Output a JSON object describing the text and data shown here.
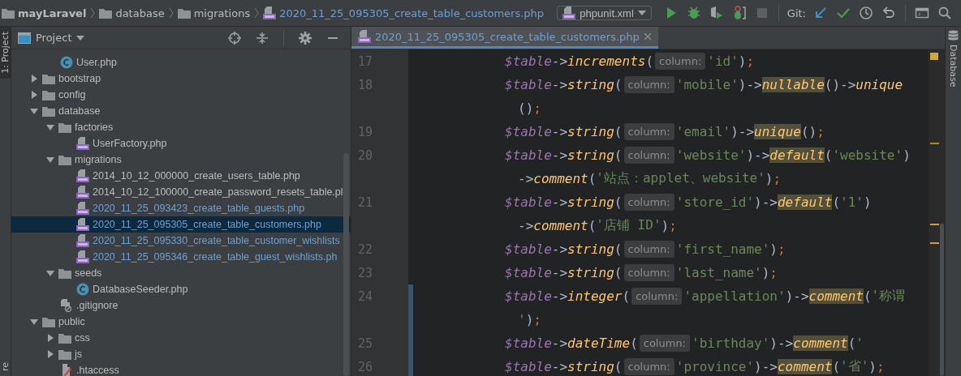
{
  "breadcrumbs": [
    {
      "kind": "project",
      "label": "mayLaravel"
    },
    {
      "kind": "folder",
      "label": "database"
    },
    {
      "kind": "folder",
      "label": "migrations"
    },
    {
      "kind": "php",
      "label": "2020_11_25_095305_create_table_customers.php"
    }
  ],
  "run_config": {
    "label": "phpunit.xml"
  },
  "vcs": {
    "label": "Git:"
  },
  "left_strip": [
    {
      "label": "1: Project",
      "selected": true
    },
    {
      "label": "re",
      "selected": false
    }
  ],
  "right_strip": [
    {
      "label": "Database"
    }
  ],
  "project_panel": {
    "title": "Project",
    "tree": {
      "continued_children": [
        {
          "kind": "class",
          "name": "User.php",
          "modified": false,
          "selected": false
        }
      ],
      "items": [
        {
          "kind": "folder",
          "name": "bootstrap",
          "expanded": false,
          "modified": false,
          "selected": false
        },
        {
          "kind": "folder",
          "name": "config",
          "expanded": false,
          "modified": false,
          "selected": false
        },
        {
          "kind": "folder",
          "name": "database",
          "expanded": true,
          "modified": false,
          "selected": false,
          "children": [
            {
              "kind": "folder",
              "name": "factories",
              "expanded": true,
              "modified": false,
              "selected": false,
              "children": [
                {
                  "kind": "php",
                  "name": "UserFactory.php",
                  "modified": false,
                  "selected": false
                }
              ]
            },
            {
              "kind": "folder",
              "name": "migrations",
              "expanded": true,
              "modified": false,
              "selected": false,
              "children": [
                {
                  "kind": "php",
                  "name": "2014_10_12_000000_create_users_table.php",
                  "modified": false,
                  "selected": false
                },
                {
                  "kind": "php",
                  "name": "2014_10_12_100000_create_password_resets_table.pl",
                  "modified": false,
                  "selected": false
                },
                {
                  "kind": "php",
                  "name": "2020_11_25_093423_create_table_guests.php",
                  "modified": true,
                  "selected": false
                },
                {
                  "kind": "php",
                  "name": "2020_11_25_095305_create_table_customers.php",
                  "modified": true,
                  "selected": true
                },
                {
                  "kind": "php",
                  "name": "2020_11_25_095330_create_table_customer_wishlists",
                  "modified": true,
                  "selected": false
                },
                {
                  "kind": "php",
                  "name": "2020_11_25_095346_create_table_guest_wishlists.ph",
                  "modified": true,
                  "selected": false
                }
              ]
            },
            {
              "kind": "folder",
              "name": "seeds",
              "expanded": true,
              "modified": false,
              "selected": false,
              "children": [
                {
                  "kind": "class",
                  "name": "DatabaseSeeder.php",
                  "modified": false,
                  "selected": false
                }
              ]
            },
            {
              "kind": "ignore",
              "name": ".gitignore",
              "modified": false,
              "selected": false
            }
          ]
        },
        {
          "kind": "folder",
          "name": "public",
          "expanded": true,
          "modified": false,
          "selected": false,
          "children": [
            {
              "kind": "folder",
              "name": "css",
              "expanded": false,
              "modified": false,
              "selected": false
            },
            {
              "kind": "folder",
              "name": "js",
              "expanded": false,
              "modified": false,
              "selected": false
            },
            {
              "kind": "htaccess",
              "name": ".htaccess",
              "modified": false,
              "selected": false
            }
          ]
        }
      ]
    }
  },
  "editor": {
    "tabs": [
      {
        "label": "2020_11_25_095305_create_table_customers.php",
        "selected": true
      }
    ],
    "lines": [
      {
        "number": "17",
        "changed": false,
        "continuation": false,
        "tokens": [
          {
            "kind": "var",
            "text": "$table"
          },
          {
            "kind": "punct",
            "text": "->"
          },
          {
            "kind": "method",
            "text": "increments"
          },
          {
            "kind": "punct",
            "text": "("
          },
          {
            "kind": "hint",
            "text": "column:"
          },
          {
            "kind": "str",
            "text": "'id'"
          },
          {
            "kind": "punct",
            "text": ")"
          },
          {
            "kind": "semi",
            "text": ";"
          }
        ]
      },
      {
        "number": "18",
        "changed": false,
        "continuation": false,
        "tokens": [
          {
            "kind": "var",
            "text": "$table"
          },
          {
            "kind": "punct",
            "text": "->"
          },
          {
            "kind": "method",
            "text": "string"
          },
          {
            "kind": "punct",
            "text": "("
          },
          {
            "kind": "hint",
            "text": "column:"
          },
          {
            "kind": "str",
            "text": "'mobile'"
          },
          {
            "kind": "punct",
            "text": ")->"
          },
          {
            "kind": "method_hl",
            "text": "nullable"
          },
          {
            "kind": "punct",
            "text": "()->"
          },
          {
            "kind": "method",
            "text": "unique"
          }
        ]
      },
      {
        "changed": false,
        "continuation": true,
        "tokens": [
          {
            "kind": "punct",
            "text": "()"
          },
          {
            "kind": "semi",
            "text": ";"
          }
        ]
      },
      {
        "number": "19",
        "changed": false,
        "continuation": false,
        "tokens": [
          {
            "kind": "var",
            "text": "$table"
          },
          {
            "kind": "punct",
            "text": "->"
          },
          {
            "kind": "method",
            "text": "string"
          },
          {
            "kind": "punct",
            "text": "("
          },
          {
            "kind": "hint",
            "text": "column:"
          },
          {
            "kind": "str",
            "text": "'email'"
          },
          {
            "kind": "punct",
            "text": ")->"
          },
          {
            "kind": "method_hl",
            "text": "unique"
          },
          {
            "kind": "punct",
            "text": "()"
          },
          {
            "kind": "semi",
            "text": ";"
          }
        ]
      },
      {
        "number": "20",
        "changed": false,
        "continuation": false,
        "tokens": [
          {
            "kind": "var",
            "text": "$table"
          },
          {
            "kind": "punct",
            "text": "->"
          },
          {
            "kind": "method",
            "text": "string"
          },
          {
            "kind": "punct",
            "text": "("
          },
          {
            "kind": "hint",
            "text": "column:"
          },
          {
            "kind": "str",
            "text": "'website'"
          },
          {
            "kind": "punct",
            "text": ")->"
          },
          {
            "kind": "method_hl",
            "text": "default"
          },
          {
            "kind": "punct",
            "text": "("
          },
          {
            "kind": "str",
            "text": "'website'"
          },
          {
            "kind": "punct",
            "text": ")"
          }
        ]
      },
      {
        "changed": false,
        "continuation": true,
        "tokens": [
          {
            "kind": "punct",
            "text": "->"
          },
          {
            "kind": "method",
            "text": "comment"
          },
          {
            "kind": "punct",
            "text": "("
          },
          {
            "kind": "str",
            "text": "'站点：applet、website'"
          },
          {
            "kind": "punct",
            "text": ")"
          },
          {
            "kind": "semi",
            "text": ";"
          }
        ]
      },
      {
        "number": "21",
        "changed": false,
        "continuation": false,
        "tokens": [
          {
            "kind": "var",
            "text": "$table"
          },
          {
            "kind": "punct",
            "text": "->"
          },
          {
            "kind": "method",
            "text": "string"
          },
          {
            "kind": "punct",
            "text": "("
          },
          {
            "kind": "hint",
            "text": "column:"
          },
          {
            "kind": "str",
            "text": "'store_id'"
          },
          {
            "kind": "punct",
            "text": ")->"
          },
          {
            "kind": "method_hl",
            "text": "default"
          },
          {
            "kind": "punct",
            "text": "("
          },
          {
            "kind": "str",
            "text": "'1'"
          },
          {
            "kind": "punct",
            "text": ")"
          }
        ]
      },
      {
        "changed": false,
        "continuation": true,
        "tokens": [
          {
            "kind": "punct",
            "text": "->"
          },
          {
            "kind": "method",
            "text": "comment"
          },
          {
            "kind": "punct",
            "text": "("
          },
          {
            "kind": "str",
            "text": "'店铺 ID'"
          },
          {
            "kind": "punct",
            "text": ")"
          },
          {
            "kind": "semi",
            "text": ";"
          }
        ]
      },
      {
        "number": "22",
        "changed": false,
        "continuation": false,
        "tokens": [
          {
            "kind": "var",
            "text": "$table"
          },
          {
            "kind": "punct",
            "text": "->"
          },
          {
            "kind": "method",
            "text": "string"
          },
          {
            "kind": "punct",
            "text": "("
          },
          {
            "kind": "hint",
            "text": "column:"
          },
          {
            "kind": "str",
            "text": "'first_name'"
          },
          {
            "kind": "punct",
            "text": ")"
          },
          {
            "kind": "semi",
            "text": ";"
          }
        ]
      },
      {
        "number": "23",
        "changed": false,
        "continuation": false,
        "tokens": [
          {
            "kind": "var",
            "text": "$table"
          },
          {
            "kind": "punct",
            "text": "->"
          },
          {
            "kind": "method",
            "text": "string"
          },
          {
            "kind": "punct",
            "text": "("
          },
          {
            "kind": "hint",
            "text": "column:"
          },
          {
            "kind": "str",
            "text": "'last_name'"
          },
          {
            "kind": "punct",
            "text": ")"
          },
          {
            "kind": "semi",
            "text": ";"
          }
        ]
      },
      {
        "number": "24",
        "changed": true,
        "continuation": false,
        "tokens": [
          {
            "kind": "var",
            "text": "$table"
          },
          {
            "kind": "punct",
            "text": "->"
          },
          {
            "kind": "method",
            "text": "integer"
          },
          {
            "kind": "punct",
            "text": "("
          },
          {
            "kind": "hint",
            "text": "column:"
          },
          {
            "kind": "str",
            "text": "'appellation'"
          },
          {
            "kind": "punct",
            "text": ")->"
          },
          {
            "kind": "method_hl",
            "text": "comment"
          },
          {
            "kind": "punct",
            "text": "("
          },
          {
            "kind": "str",
            "text": "'称谓"
          }
        ]
      },
      {
        "changed": true,
        "continuation": true,
        "tokens": [
          {
            "kind": "str",
            "text": "'"
          },
          {
            "kind": "punct",
            "text": ")"
          },
          {
            "kind": "semi",
            "text": ";"
          }
        ]
      },
      {
        "number": "25",
        "changed": true,
        "continuation": false,
        "tokens": [
          {
            "kind": "var",
            "text": "$table"
          },
          {
            "kind": "punct",
            "text": "->"
          },
          {
            "kind": "method",
            "text": "dateTime"
          },
          {
            "kind": "punct",
            "text": "("
          },
          {
            "kind": "hint",
            "text": "column:"
          },
          {
            "kind": "str",
            "text": "'birthday'"
          },
          {
            "kind": "punct",
            "text": ")->"
          },
          {
            "kind": "method_hl",
            "text": "comment"
          },
          {
            "kind": "punct",
            "text": "("
          },
          {
            "kind": "str",
            "text": "'"
          }
        ]
      },
      {
        "number": "26",
        "changed": true,
        "continuation": false,
        "tokens": [
          {
            "kind": "var",
            "text": "$table"
          },
          {
            "kind": "punct",
            "text": "->"
          },
          {
            "kind": "method",
            "text": "string"
          },
          {
            "kind": "punct",
            "text": "("
          },
          {
            "kind": "hint",
            "text": "column:"
          },
          {
            "kind": "str",
            "text": "'province'"
          },
          {
            "kind": "punct",
            "text": ")->"
          },
          {
            "kind": "method_hl",
            "text": "comment"
          },
          {
            "kind": "punct",
            "text": "("
          },
          {
            "kind": "str",
            "text": "'省'"
          },
          {
            "kind": "punct",
            "text": ")"
          },
          {
            "kind": "semi",
            "text": ";"
          }
        ]
      }
    ]
  }
}
